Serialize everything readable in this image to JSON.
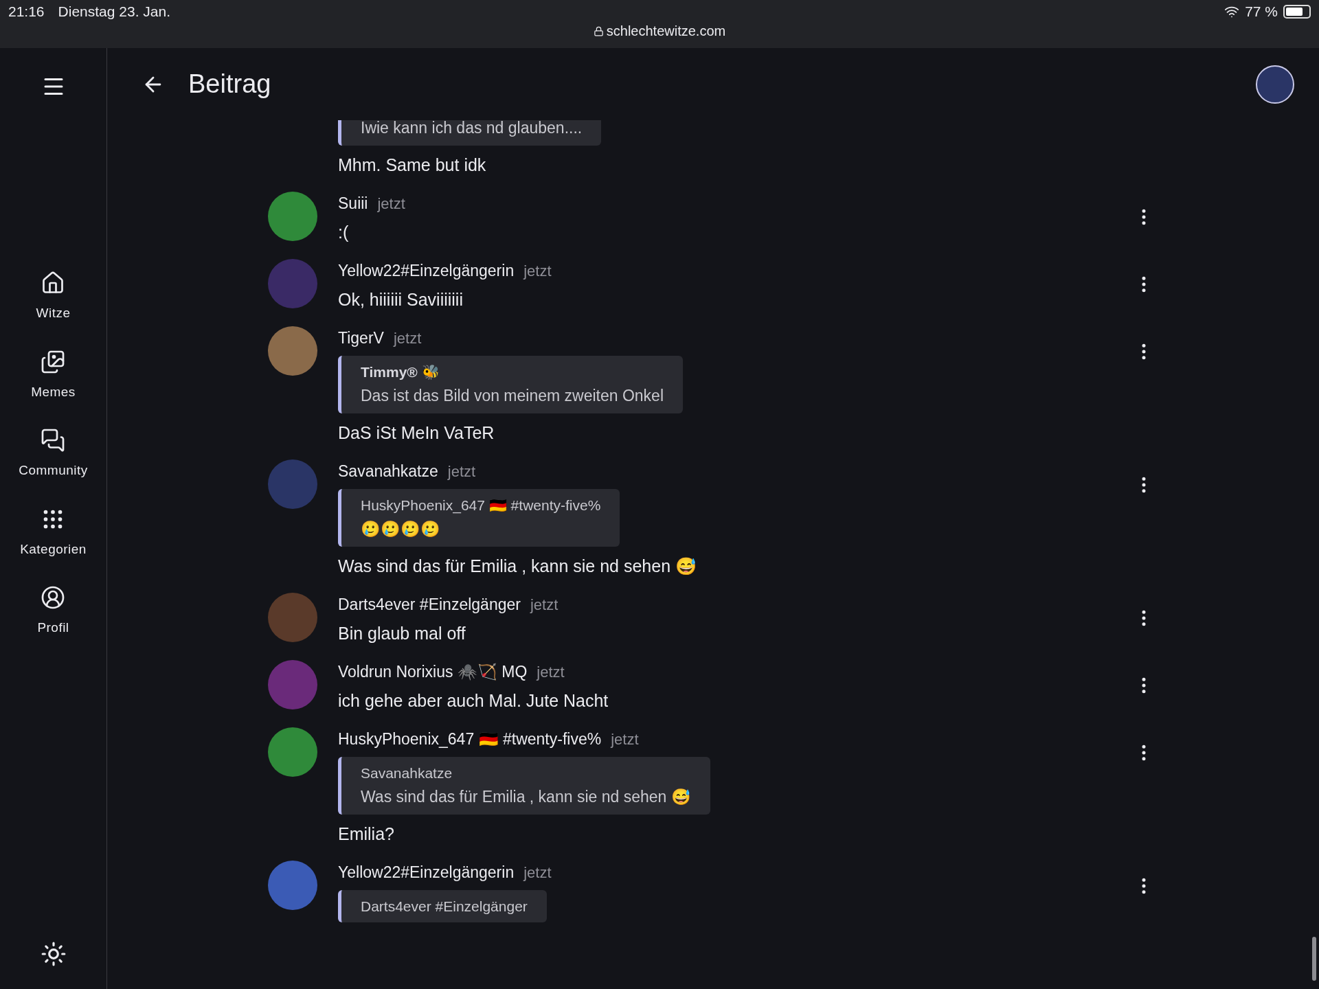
{
  "status_bar": {
    "time": "21:16",
    "date": "Dienstag 23. Jan.",
    "url": "schlechtewitze.com",
    "battery": "77 %"
  },
  "sidebar": {
    "items": [
      {
        "label": "Witze",
        "kind": "home"
      },
      {
        "label": "Memes",
        "kind": "images"
      },
      {
        "label": "Community",
        "kind": "chat"
      },
      {
        "label": "Kategorien",
        "kind": "grid"
      },
      {
        "label": "Profil",
        "kind": "profile"
      }
    ]
  },
  "header": {
    "title": "Beitrag"
  },
  "comments": [
    {
      "quote": {
        "text": "Iwie kann ich das nd glauben...."
      },
      "text": "Mhm. Same but idk"
    },
    {
      "author": "Suiii",
      "time": "jetzt",
      "text": ":("
    },
    {
      "author": "Yellow22#Einzelgängerin",
      "time": "jetzt",
      "text": "Ok, hiiiiii Saviiiiiii"
    },
    {
      "author": "TigerV",
      "time": "jetzt",
      "quote": {
        "author": "Timmy® 🐝",
        "emphasized": true,
        "text": "Das ist das Bild von meinem zweiten Onkel"
      },
      "text": "DaS iSt MeIn VaTeR"
    },
    {
      "author": "Savanahkatze",
      "time": "jetzt",
      "quote": {
        "author": "HuskyPhoenix_647 🇩🇪 #twenty-five%",
        "emphasized": false,
        "text": "🥲🥲🥲🥲"
      },
      "text": "Was sind das für Emilia , kann sie nd sehen 😅"
    },
    {
      "author": "Darts4ever #Einzelgänger",
      "time": "jetzt",
      "text": "Bin glaub mal off"
    },
    {
      "author": "Voldrun Norixius 🕷️🏹 MQ",
      "time": "jetzt",
      "text": "ich gehe aber auch Mal. Jute Nacht"
    },
    {
      "author": "HuskyPhoenix_647 🇩🇪 #twenty-five%",
      "time": "jetzt",
      "quote": {
        "author": "Savanahkatze",
        "emphasized": false,
        "text": "Was sind das für Emilia , kann sie nd sehen 😅"
      },
      "text": "Emilia?"
    },
    {
      "author": "Yellow22#Einzelgängerin",
      "time": "jetzt",
      "quote": {
        "author": "Darts4ever #Einzelgänger",
        "emphasized": false
      }
    }
  ]
}
